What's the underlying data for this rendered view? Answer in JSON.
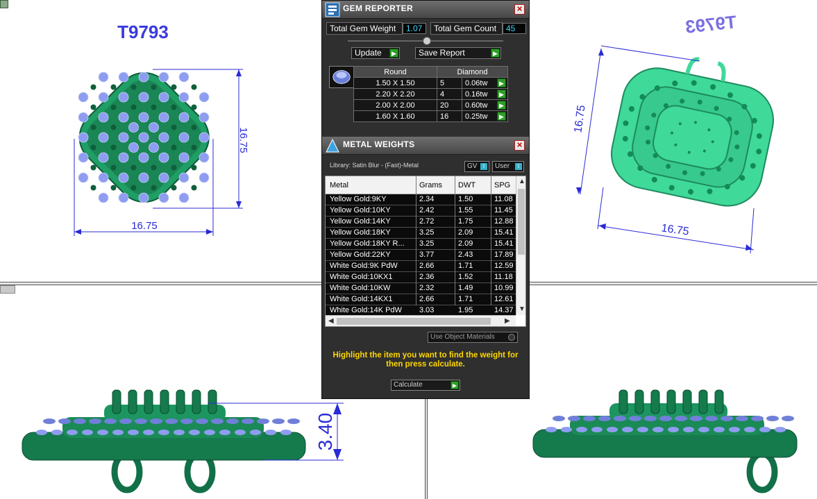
{
  "viewports": {
    "front_label": "T9793",
    "back_label": "T9793",
    "front_width": "16.75",
    "front_height": "16.75",
    "back_width": "16.75",
    "back_height": "16.75",
    "side_height": "3.40"
  },
  "colors": {
    "dimension_blue": "#2a2ad6",
    "metal_green": "#157a4c",
    "gem_blue": "#8e9df0",
    "panel_dark": "#2f2f2f",
    "value_cyan": "#3bd5f5",
    "hint_yellow": "#ffd700",
    "arrow_green": "#2f9f28"
  },
  "gem_reporter": {
    "title": "GEM REPORTER",
    "total_weight_label": "Total Gem Weight",
    "total_weight_value": "1.07",
    "total_count_label": "Total Gem Count",
    "total_count_value": "45",
    "update_label": "Update",
    "save_report_label": "Save Report",
    "table_headers": {
      "shape": "Round",
      "material": "Diamond"
    },
    "rows": [
      {
        "size": "1.50 X 1.50",
        "count": "5",
        "weight": "0.06tw"
      },
      {
        "size": "2.20 X 2.20",
        "count": "4",
        "weight": "0.16tw"
      },
      {
        "size": "2.00 X 2.00",
        "count": "20",
        "weight": "0.60tw"
      },
      {
        "size": "1.60 X 1.60",
        "count": "16",
        "weight": "0.25tw"
      }
    ]
  },
  "metal_weights": {
    "title": "METAL WEIGHTS",
    "library": "Library: Satin Blur - (Fast)-Metal",
    "gv_label": "GV",
    "user_label": "User",
    "columns": [
      "Metal",
      "Grams",
      "DWT",
      "SPG"
    ],
    "rows": [
      {
        "metal": "Yellow Gold:9KY",
        "grams": "2.34",
        "dwt": "1.50",
        "spg": "11.08"
      },
      {
        "metal": "Yellow Gold:10KY",
        "grams": "2.42",
        "dwt": "1.55",
        "spg": "11.45"
      },
      {
        "metal": "Yellow Gold:14KY",
        "grams": "2.72",
        "dwt": "1.75",
        "spg": "12.88"
      },
      {
        "metal": "Yellow Gold:18KY",
        "grams": "3.25",
        "dwt": "2.09",
        "spg": "15.41"
      },
      {
        "metal": "Yellow Gold:18KY R...",
        "grams": "3.25",
        "dwt": "2.09",
        "spg": "15.41"
      },
      {
        "metal": "Yellow Gold:22KY",
        "grams": "3.77",
        "dwt": "2.43",
        "spg": "17.89"
      },
      {
        "metal": "White Gold:9K PdW",
        "grams": "2.66",
        "dwt": "1.71",
        "spg": "12.59"
      },
      {
        "metal": "White Gold:10KX1",
        "grams": "2.36",
        "dwt": "1.52",
        "spg": "11.18"
      },
      {
        "metal": "White Gold:10KW",
        "grams": "2.32",
        "dwt": "1.49",
        "spg": "10.99"
      },
      {
        "metal": "White Gold:14KX1",
        "grams": "2.66",
        "dwt": "1.71",
        "spg": "12.61"
      },
      {
        "metal": "White Gold:14K PdW",
        "grams": "3.03",
        "dwt": "1.95",
        "spg": "14.37"
      }
    ],
    "use_object_materials": "Use Object Materials",
    "hint": "Highlight the item you want to find the weight for then press calculate.",
    "calculate_label": "Calculate"
  }
}
